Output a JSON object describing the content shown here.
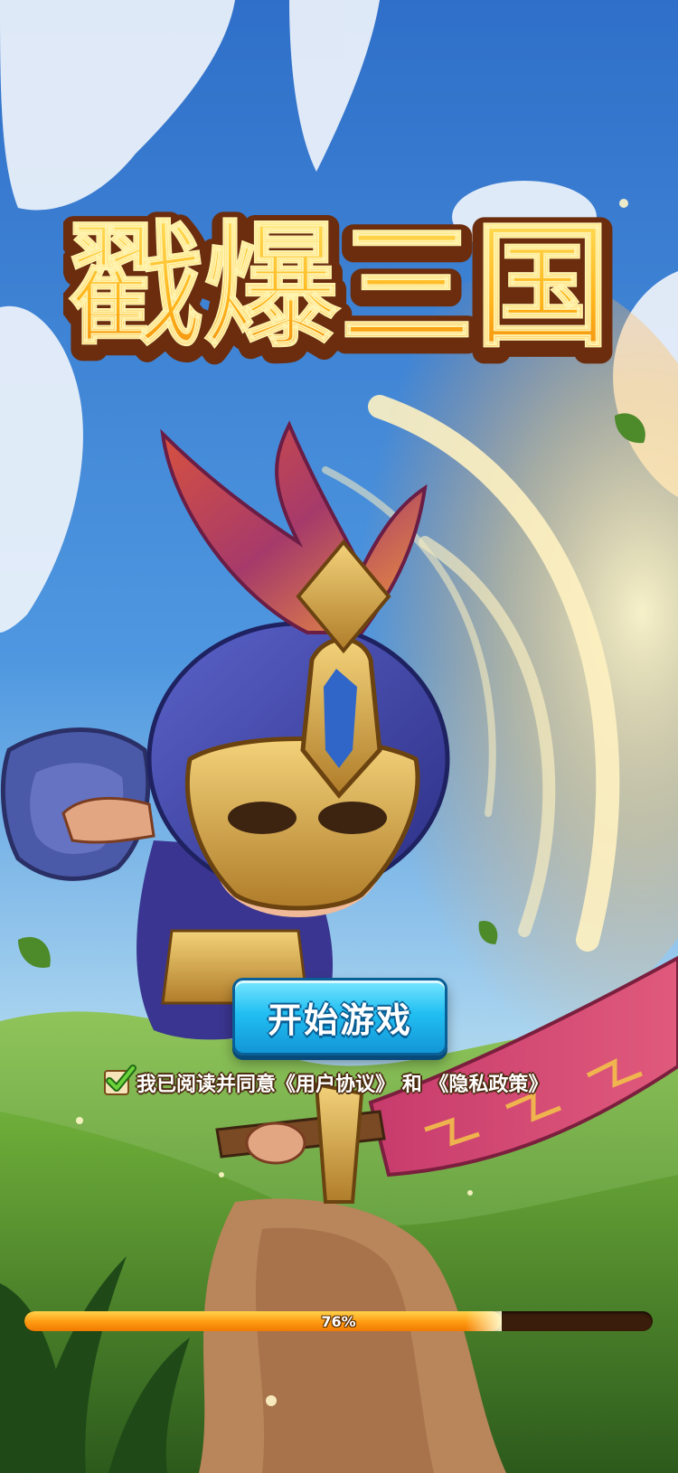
{
  "game": {
    "title": "戳爆三国"
  },
  "start_button": {
    "label": "开始游戏"
  },
  "agreement": {
    "checked": true,
    "prefix": "我已阅读并同意",
    "user_agreement": "《用户协议》",
    "connector": "和",
    "privacy_policy": "《隐私政策》"
  },
  "loading": {
    "progress": 0.76,
    "label": "76%"
  },
  "colors": {
    "sky": "#3f86d6",
    "button": "#22bff2",
    "progress_fill": "#ff9a12",
    "title_gold": "#ffc21e",
    "title_outline": "#6b2d0e"
  }
}
